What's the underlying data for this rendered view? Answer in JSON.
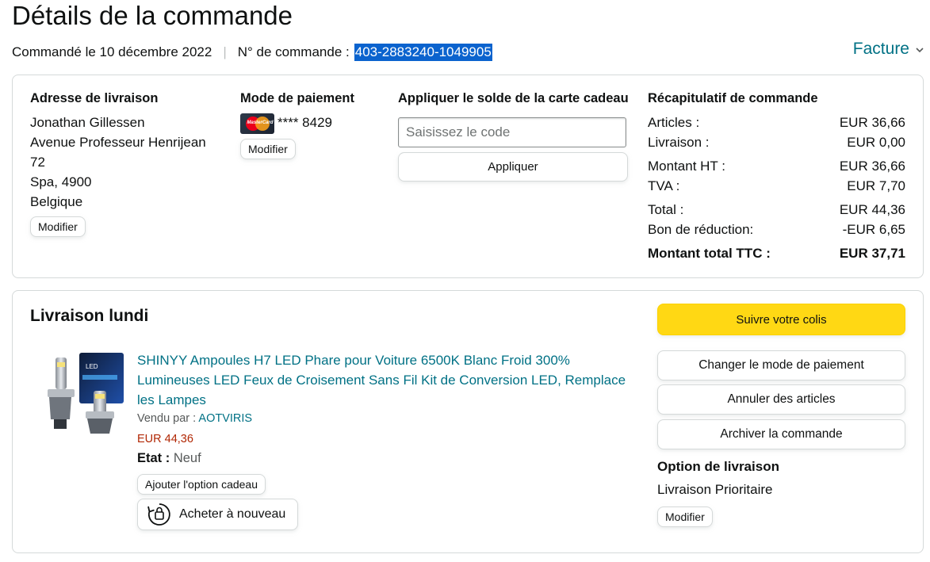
{
  "header": {
    "title": "Détails de la commande",
    "ordered_on": "Commandé le 10 décembre 2022",
    "separator": "|",
    "order_number_label": "N° de commande :",
    "order_number_value": "403-2883240-1049905",
    "invoice_label": "Facture",
    "invoice_chevron": "chevron-down-icon"
  },
  "shipping_address": {
    "title": "Adresse de livraison",
    "lines": [
      "Jonathan Gillessen",
      "Avenue Professeur Henrijean",
      "72",
      "Spa, 4900",
      "Belgique"
    ],
    "edit_label": "Modifier"
  },
  "payment": {
    "title": "Mode de paiement",
    "card_icon": "mastercard-icon",
    "card_logo_text": "MasterCard",
    "card_masked": "**** 8429",
    "edit_label": "Modifier"
  },
  "gift_card": {
    "title": "Appliquer le solde de la carte cadeau",
    "input_placeholder": "Saisissez le code",
    "input_value": "",
    "apply_label": "Appliquer"
  },
  "summary": {
    "title": "Récapitulatif de commande",
    "rows": [
      {
        "label": "Articles :",
        "value": "EUR 36,66"
      },
      {
        "label": "Livraison :",
        "value": "EUR 0,00"
      },
      {
        "label": "Montant HT :",
        "value": "EUR 36,66"
      },
      {
        "label": "TVA :",
        "value": "EUR 7,70"
      },
      {
        "label": "Total :",
        "value": "EUR 44,36"
      },
      {
        "label": "Bon de réduction:",
        "value": "-EUR 6,65"
      },
      {
        "label": "Montant total TTC :",
        "value": "EUR 37,71"
      }
    ]
  },
  "delivery": {
    "title": "Livraison lundi",
    "product": {
      "title": "SHINYY Ampoules H7 LED Phare pour Voiture 6500K Blanc Froid 300% Lumineuses LED Feux de Croisement Sans Fil Kit de Conversion LED, Remplace les Lampes",
      "image_icon": "led-bulb-product-image",
      "seller_label": "Vendu par :",
      "seller_name": "AOTVIRIS",
      "price": "EUR 44,36",
      "condition_label": "Etat :",
      "condition_value": "Neuf",
      "gift_option_label": "Ajouter l'option cadeau",
      "buy_again_label": "Acheter à nouveau",
      "buy_again_icon": "buy-again-icon"
    },
    "actions": {
      "track": "Suivre votre colis",
      "change_payment": "Changer le mode de paiement",
      "cancel_items": "Annuler des articles",
      "archive": "Archiver la commande"
    },
    "shipping_option": {
      "title": "Option de livraison",
      "value": "Livraison Prioritaire",
      "edit_label": "Modifier"
    }
  },
  "colors": {
    "link": "#007185",
    "price": "#b12704",
    "primary_button": "#ffd814",
    "selection": "#0b63ce",
    "border": "#d5d9d9"
  }
}
